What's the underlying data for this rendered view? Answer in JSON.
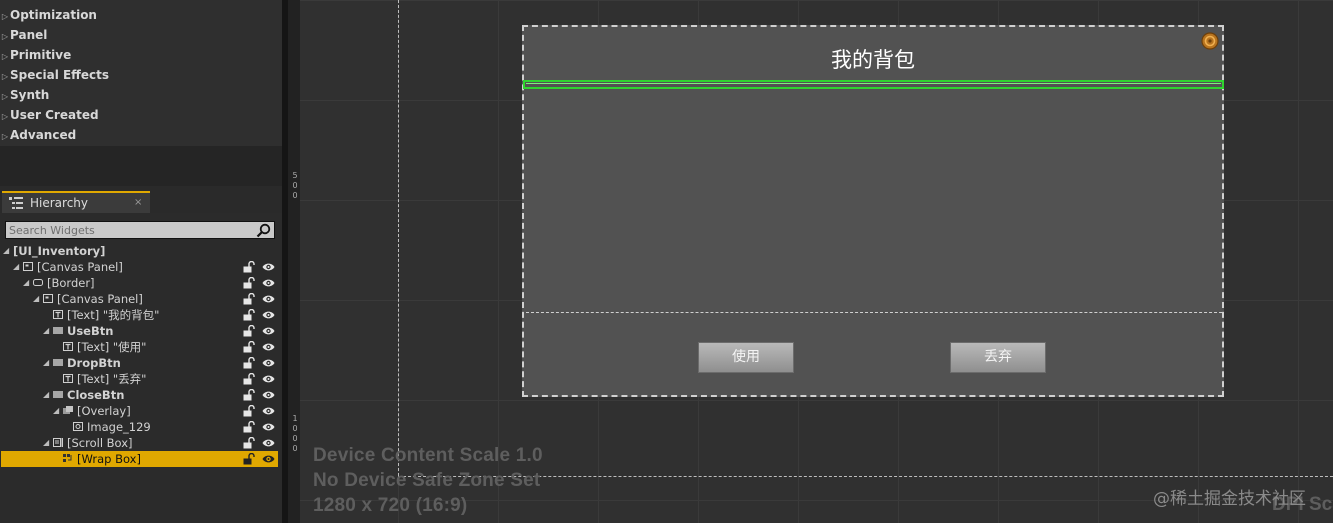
{
  "palette": {
    "categories": [
      "Optimization",
      "Panel",
      "Primitive",
      "Special Effects",
      "Synth",
      "User Created",
      "Advanced"
    ]
  },
  "hierarchy": {
    "tab_label": "Hierarchy",
    "close_glyph": "×",
    "search_placeholder": "Search Widgets",
    "rows": [
      {
        "label": "[UI_Inventory]",
        "indent": 0,
        "bold": true,
        "arrow": true,
        "icon": "none",
        "controls": false,
        "selected": false
      },
      {
        "label": "[Canvas Panel]",
        "indent": 1,
        "bold": false,
        "arrow": true,
        "icon": "canvas-panel-icon",
        "controls": true,
        "selected": false
      },
      {
        "label": "[Border]",
        "indent": 2,
        "bold": false,
        "arrow": true,
        "icon": "border-icon",
        "controls": true,
        "selected": false
      },
      {
        "label": "[Canvas Panel]",
        "indent": 3,
        "bold": false,
        "arrow": true,
        "icon": "canvas-panel-icon",
        "controls": true,
        "selected": false
      },
      {
        "label": "[Text] \"我的背包\"",
        "indent": 4,
        "bold": false,
        "arrow": false,
        "icon": "text-icon",
        "controls": true,
        "selected": false
      },
      {
        "label": "UseBtn",
        "indent": 4,
        "bold": true,
        "arrow": true,
        "icon": "button-icon",
        "controls": true,
        "selected": false
      },
      {
        "label": "[Text] \"使用\"",
        "indent": 5,
        "bold": false,
        "arrow": false,
        "icon": "text-icon",
        "controls": true,
        "selected": false
      },
      {
        "label": "DropBtn",
        "indent": 4,
        "bold": true,
        "arrow": true,
        "icon": "button-icon",
        "controls": true,
        "selected": false
      },
      {
        "label": "[Text] \"丢弃\"",
        "indent": 5,
        "bold": false,
        "arrow": false,
        "icon": "text-icon",
        "controls": true,
        "selected": false
      },
      {
        "label": "CloseBtn",
        "indent": 4,
        "bold": true,
        "arrow": true,
        "icon": "button-icon",
        "controls": true,
        "selected": false
      },
      {
        "label": "[Overlay]",
        "indent": 5,
        "bold": false,
        "arrow": true,
        "icon": "overlay-icon",
        "controls": true,
        "selected": false
      },
      {
        "label": "Image_129",
        "indent": 6,
        "bold": false,
        "arrow": false,
        "icon": "image-icon",
        "controls": true,
        "selected": false
      },
      {
        "label": "[Scroll Box]",
        "indent": 4,
        "bold": false,
        "arrow": true,
        "icon": "scroll-box-icon",
        "controls": true,
        "selected": false
      },
      {
        "label": "[Wrap Box]",
        "indent": 5,
        "bold": false,
        "arrow": false,
        "icon": "wrap-box-icon",
        "controls": true,
        "selected": true
      }
    ]
  },
  "ruler": {
    "mark_500": [
      "5",
      "0",
      "0"
    ],
    "mark_1000": [
      "1",
      "0",
      "0",
      "0"
    ]
  },
  "canvas": {
    "title": "我的背包",
    "use_button": "使用",
    "drop_button": "丢弃",
    "close_icon": "close-button-icon"
  },
  "overlay_info": {
    "scale": "Device Content Scale 1.0",
    "safe_zone": "No Device Safe Zone Set",
    "resolution": "1280 x 720 (16:9)",
    "dpi": "DPI Sca"
  },
  "watermark": "@稀土掘金技术社区",
  "colors": {
    "selection": "#e0a800",
    "wrap_box_outline": "#2fd52f",
    "panel_bg": "#525252",
    "viewport_bg": "#303030"
  }
}
